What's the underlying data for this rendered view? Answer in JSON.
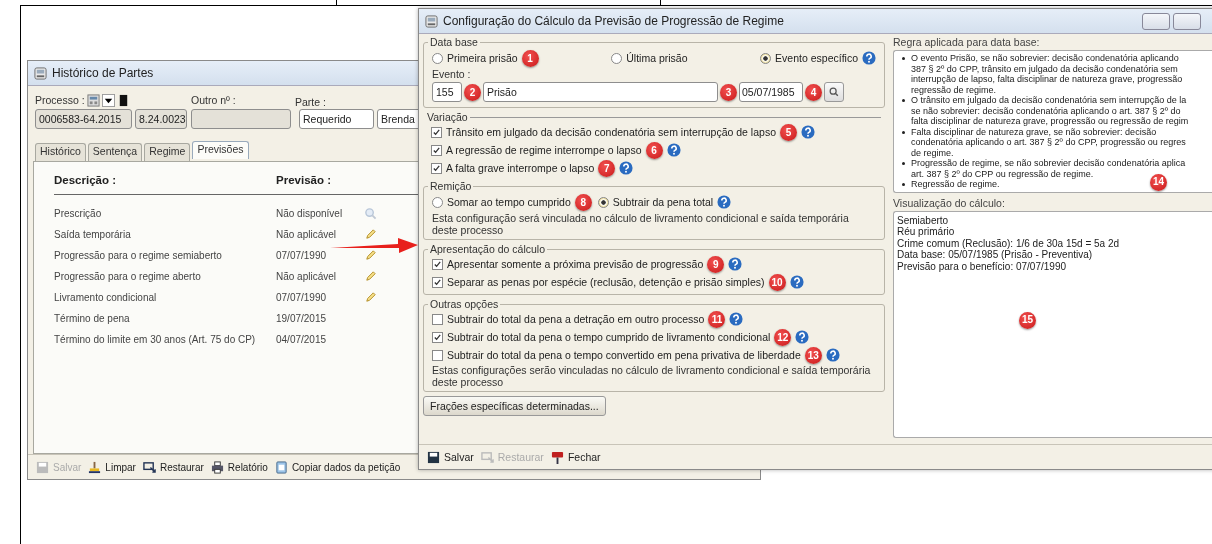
{
  "left_window": {
    "title": "Histórico de Partes",
    "process_label": "Processo :",
    "process_number": "0006583-64.2015",
    "process_suffix": "8.24.0023",
    "other_label": "Outro nº :",
    "party_label": "Parte :",
    "party_role": "Requerido",
    "party_name": "Brenda",
    "tabs": [
      {
        "label": "Histórico",
        "selected": false
      },
      {
        "label": "Sentença",
        "selected": false
      },
      {
        "label": "Regime",
        "selected": false
      },
      {
        "label": "Previsões",
        "selected": true
      }
    ],
    "columns": [
      "Descrição :",
      "Previsão :"
    ],
    "rows": [
      {
        "description": "Prescrição",
        "forecast": "Não disponível",
        "kind": "search"
      },
      {
        "description": "Saída temporária",
        "forecast": "Não aplicável",
        "kind": "edit"
      },
      {
        "description": "Progressão para o regime semiaberto",
        "forecast": "07/07/1990",
        "kind": "edit"
      },
      {
        "description": "Progressão para o regime aberto",
        "forecast": "Não aplicável",
        "kind": "edit"
      },
      {
        "description": "Livramento condicional",
        "forecast": "07/07/1990",
        "kind": "edit"
      },
      {
        "description": "Término de pena",
        "forecast": "19/07/2015",
        "kind": "plain"
      },
      {
        "description": "Término do limite em 30 anos (Art. 75 do CP)",
        "forecast": "04/07/2015",
        "kind": "plain"
      }
    ],
    "toolbar": [
      {
        "label": "Salvar",
        "kind": "save",
        "disabled": true
      },
      {
        "label": "Limpar",
        "kind": "clean",
        "disabled": false
      },
      {
        "label": "Restaurar",
        "kind": "restore",
        "disabled": false
      },
      {
        "label": "Relatório",
        "kind": "print",
        "disabled": false
      },
      {
        "label": "Copiar dados da petição",
        "kind": "copy",
        "disabled": false
      }
    ]
  },
  "dialog": {
    "title": "Configuração do Cálculo da Previsão de Progressão de Regime",
    "data_base": {
      "legend": "Data base",
      "options": [
        {
          "label": "Primeira prisão",
          "selected": false,
          "callout": "1"
        },
        {
          "label": "Última prisão",
          "selected": false
        },
        {
          "label": "Evento específico",
          "selected": true,
          "help": true
        }
      ],
      "event_label": "Evento :",
      "event_code": "155",
      "event_code_callout": "2",
      "event_name": "Prisão",
      "event_name_callout": "3",
      "event_date": "05/07/1985",
      "event_date_callout": "4"
    },
    "variation": {
      "legend": "Variação",
      "items": [
        {
          "label": "Trânsito em julgado da decisão condenatória sem interrupção de lapso",
          "checked": true,
          "callout": "5",
          "help": true
        },
        {
          "label": "A regressão de regime interrompe o lapso",
          "checked": true,
          "callout": "6",
          "help": true
        },
        {
          "label": "A falta grave interrompe o lapso",
          "checked": true,
          "callout": "7",
          "help": true
        }
      ]
    },
    "remission": {
      "legend": "Remição",
      "options": [
        {
          "label": "Somar ao tempo cumprido",
          "selected": false,
          "callout": "8"
        },
        {
          "label": "Subtrair da pena total",
          "selected": true,
          "help": true
        }
      ],
      "note": "Esta configuração será vinculada no cálculo de livramento condicional e saída temporária deste processo"
    },
    "presentation": {
      "legend": "Apresentação do cálculo",
      "items": [
        {
          "label": "Apresentar somente a próxima previsão de progressão",
          "checked": true,
          "callout": "9",
          "help": true
        },
        {
          "label": "Separar as penas por espécie (reclusão, detenção e prisão simples)",
          "checked": true,
          "callout": "10",
          "help": true
        }
      ]
    },
    "other_options": {
      "legend": "Outras opções",
      "items": [
        {
          "label": "Subtrair do total da pena a detração em outro processo",
          "checked": false,
          "callout": "11",
          "help": true
        },
        {
          "label": "Subtrair do total da pena o tempo cumprido de livramento condicional",
          "checked": true,
          "callout": "12",
          "help": true
        },
        {
          "label": "Subtrair do total da pena o tempo convertido em pena privativa de liberdade",
          "checked": false,
          "callout": "13",
          "help": true
        }
      ],
      "note": "Estas configurações serão vinculadas no cálculo de livramento condicional e saída temporária deste processo"
    },
    "fractions_button": "Frações específicas determinadas...",
    "toolbar": [
      {
        "label": "Salvar",
        "kind": "save",
        "disabled": false
      },
      {
        "label": "Restaurar",
        "kind": "restore",
        "disabled": true
      },
      {
        "label": "Fechar",
        "kind": "close",
        "disabled": false
      }
    ],
    "rules": {
      "label": "Regra aplicada para data base:",
      "callout": "14",
      "bullets": [
        [
          "O evento Prisão, se não sobrevier: decisão condenatória aplicando",
          "387 § 2º do CPP, trânsito em julgado da decisão condenatória sem",
          "interrupção de lapso, falta disciplinar de natureza grave, progressão",
          "regressão de regime."
        ],
        [
          "O trânsito em julgado da decisão condenatória sem interrupção de la",
          "se não sobrevier: decisão condenatória aplicando o art. 387 § 2º do",
          "falta disciplinar de natureza grave, progressão ou regressão de regim"
        ],
        [
          "Falta disciplinar de natureza grave, se não sobrevier: decisão",
          "condenatória aplicando o art. 387 § 2º do CPP, progressão ou regres",
          "de regime."
        ],
        [
          "Progressão de regime, se não sobrevier decisão condenatória aplica",
          "art. 387 § 2º do CPP ou regressão de regime."
        ],
        [
          "Regressão de regime."
        ]
      ]
    },
    "preview": {
      "label": "Visualização do cálculo:",
      "callout": "15",
      "lines": [
        "Semiaberto",
        "Réu primário",
        "Crime comum (Reclusão): 1/6 de 30a 15d = 5a 2d",
        "Data base: 05/07/1985 (Prisão - Preventiva)",
        "Previsão para o benefício: 07/07/1990"
      ]
    }
  }
}
